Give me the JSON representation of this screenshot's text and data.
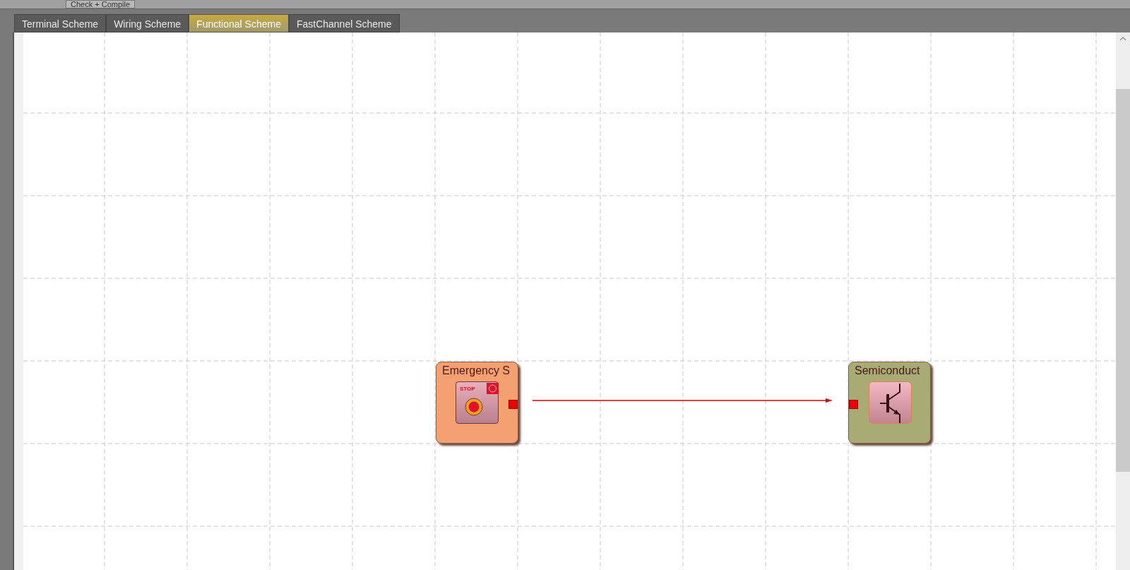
{
  "toolbar": {
    "buttons": [
      "Check + Compile"
    ]
  },
  "tabs": [
    {
      "label": "Terminal Scheme",
      "selected": false
    },
    {
      "label": "Wiring Scheme",
      "selected": false
    },
    {
      "label": "Functional Scheme",
      "selected": true
    },
    {
      "label": "FastChannel Scheme",
      "selected": false
    }
  ],
  "canvas": {
    "blocks": [
      {
        "kind": "emergency-stop",
        "title": "Emergency S",
        "stop_label": "STOP",
        "color": "#f4a070"
      },
      {
        "kind": "semiconductor",
        "title": "Semiconduct",
        "color": "#a8ab73"
      }
    ]
  }
}
